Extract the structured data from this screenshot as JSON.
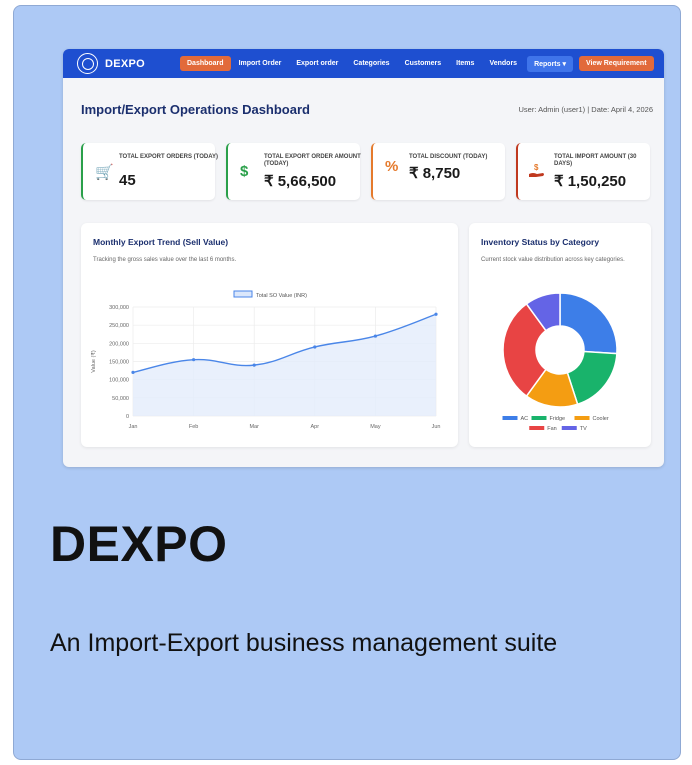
{
  "nav": {
    "brand": "DEXPO",
    "items": [
      "Dashboard",
      "Import Order",
      "Export order",
      "Categories",
      "Customers",
      "Items",
      "Vendors"
    ],
    "reports": "Reports",
    "view_requirement": "View Requirement"
  },
  "header": {
    "title": "Import/Export Operations Dashboard",
    "user_info": "User: Admin (user1) | Date: April 4, 2026"
  },
  "kpis": [
    {
      "label": "TOTAL EXPORT ORDERS (TODAY)",
      "value": "45",
      "icon": "cart-icon",
      "color": "#2aa04a"
    },
    {
      "label": "TOTAL EXPORT ORDER AMOUNT (TODAY)",
      "value": "₹ 5,66,500",
      "icon": "dollar-icon",
      "color": "#2aa04a"
    },
    {
      "label": "TOTAL DISCOUNT (TODAY)",
      "value": "₹ 8,750",
      "icon": "percent-icon",
      "color": "#e57a2c"
    },
    {
      "label": "TOTAL IMPORT AMOUNT (30 DAYS)",
      "value": "₹ 1,50,250",
      "icon": "hand-dollar-icon",
      "color": "#c0391f"
    }
  ],
  "line_panel": {
    "title": "Monthly Export Trend (Sell Value)",
    "subtitle": "Tracking the gross sales value over the last 6 months."
  },
  "donut_panel": {
    "title": "Inventory Status by Category",
    "subtitle": "Current stock value distribution across key categories."
  },
  "chart_data": [
    {
      "type": "line",
      "categories": [
        "Jan",
        "Feb",
        "Mar",
        "Apr",
        "May",
        "Jun"
      ],
      "series": [
        {
          "name": "Total SO Value (INR)",
          "values": [
            120000,
            155000,
            140000,
            190000,
            220000,
            280000
          ],
          "color": "#4a86e8"
        }
      ],
      "ylabel": "Value (₹)",
      "ylim": [
        0,
        300000
      ],
      "yticks": [
        "0",
        "50,000",
        "100,000",
        "150,000",
        "200,000",
        "250,000",
        "300,000"
      ],
      "grid": true,
      "legend": "top"
    },
    {
      "type": "pie",
      "categories": [
        "AC",
        "Fridge",
        "Cooler",
        "Fan",
        "TV"
      ],
      "values": [
        26,
        19,
        15,
        30,
        10
      ],
      "colors": [
        "#3d7ee8",
        "#19b36b",
        "#f49d12",
        "#e84444",
        "#6464e6"
      ],
      "legend": "bottom"
    }
  ],
  "footer": {
    "title": "DEXPO",
    "subtitle": "An Import-Export business management suite"
  }
}
